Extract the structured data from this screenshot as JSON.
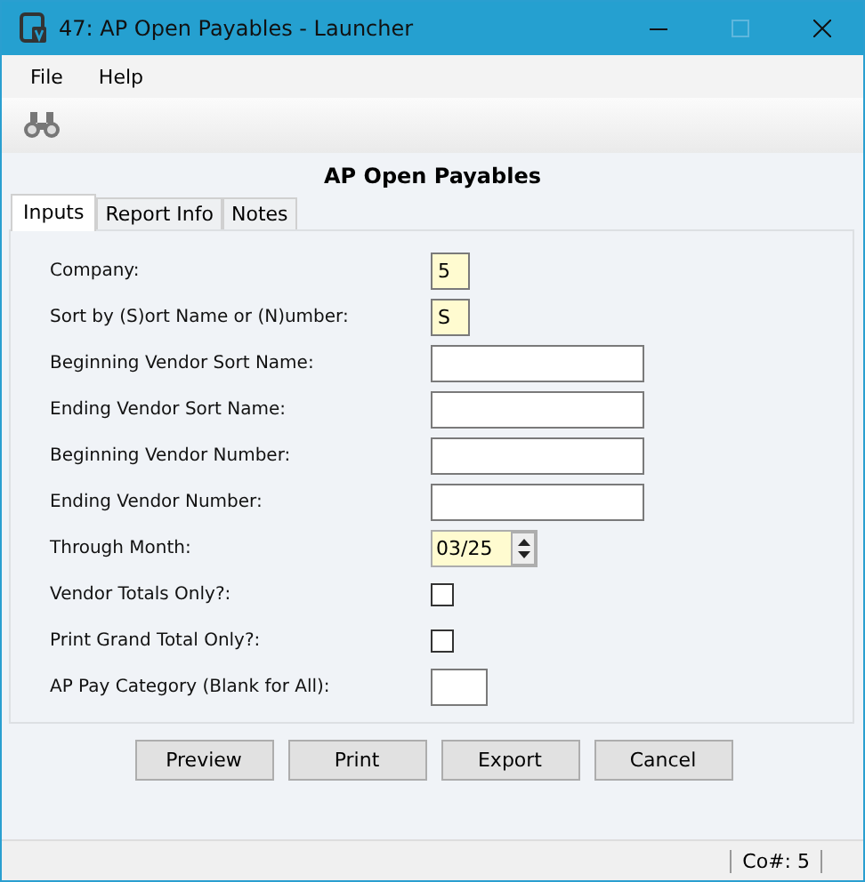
{
  "window": {
    "title": "47: AP Open Payables - Launcher"
  },
  "menu": [
    "File",
    "Help"
  ],
  "heading": "AP Open Payables",
  "tabs": [
    {
      "label": "Inputs",
      "selected": true
    },
    {
      "label": "Report Info",
      "selected": false
    },
    {
      "label": "Notes",
      "selected": false
    }
  ],
  "fields": [
    {
      "kind": "char",
      "label": "Company:",
      "value": "5"
    },
    {
      "kind": "char",
      "label": "Sort by (S)ort Name or (N)umber:",
      "value": "S"
    },
    {
      "kind": "text",
      "label": "Beginning Vendor Sort Name:"
    },
    {
      "kind": "text",
      "label": "Ending Vendor Sort Name:"
    },
    {
      "kind": "text",
      "label": "Beginning Vendor Number:"
    },
    {
      "kind": "text",
      "label": "Ending Vendor Number:"
    },
    {
      "kind": "month",
      "label": "Through Month:",
      "value": "03/25"
    },
    {
      "kind": "checkbox",
      "label": "Vendor Totals Only?:",
      "checked": false
    },
    {
      "kind": "checkbox",
      "label": "Print Grand Total Only?:",
      "checked": false
    },
    {
      "kind": "code",
      "label": "AP Pay Category (Blank for All):"
    }
  ],
  "buttons": [
    "Preview",
    "Print",
    "Export",
    "Cancel"
  ],
  "status_bar": "Co#: 5"
}
